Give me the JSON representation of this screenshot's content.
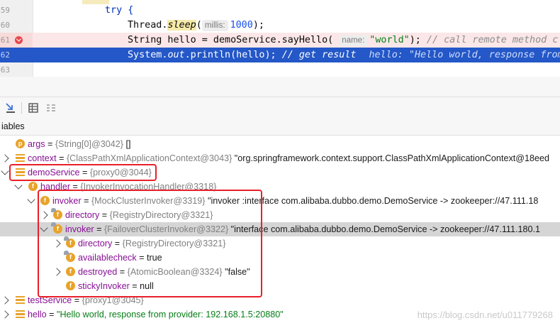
{
  "editor": {
    "lines": [
      {
        "num": "59",
        "text": "try {"
      },
      {
        "num": "60",
        "prefix": "Thread.",
        "method": "sleep",
        "hint": "millis:",
        "arg": "1000",
        "suffix": ");"
      },
      {
        "num": "61",
        "prefix": "String hello = demoService.sayHello(",
        "hint": "name:",
        "arg": "\"world\"",
        "suffix": ");",
        "comment": "// call remote method   c"
      },
      {
        "num": "62",
        "code": "System.",
        "field": "out",
        "rest": ".println(hello);",
        "comment": "// get result",
        "inline_value": "hello: \"Hello world, response from"
      },
      {
        "num": "63"
      }
    ]
  },
  "panel": {
    "title": "iables"
  },
  "tree": [
    {
      "name": "args",
      "type": "{String[0]@3042}",
      "value": "[]"
    },
    {
      "name": "context",
      "type": "{ClassPathXmlApplicationContext@3043}",
      "value": "\"org.springframework.context.support.ClassPathXmlApplicationContext@18eed"
    },
    {
      "name": "demoService",
      "type": "{proxy0@3044}",
      "value": ""
    },
    {
      "name": "handler",
      "type": "{InvokerInvocationHandler@3318}",
      "value": ""
    },
    {
      "name": "invoker",
      "type": "{MockClusterInvoker@3319}",
      "value": "\"invoker :interface com.alibaba.dubbo.demo.DemoService -> zookeeper://47.111.18"
    },
    {
      "name": "directory",
      "type": "{RegistryDirectory@3321}",
      "value": ""
    },
    {
      "name": "invoker",
      "type": "{FailoverClusterInvoker@3322}",
      "value": "\"interface com.alibaba.dubbo.demo.DemoService -> zookeeper://47.111.180.1"
    },
    {
      "name": "directory",
      "type": "{RegistryDirectory@3321}",
      "value": ""
    },
    {
      "name": "availablecheck",
      "type": "",
      "value": "= true"
    },
    {
      "name": "destroyed",
      "type": "{AtomicBoolean@3324}",
      "value": "\"false\""
    },
    {
      "name": "stickyInvoker",
      "type": "",
      "value": "= null"
    },
    {
      "name": "testService",
      "type": "{proxy1@3045}",
      "value": ""
    },
    {
      "name": "hello",
      "type": "",
      "value": "\"Hello world, response from provider: 192.168.1.5:20880\""
    }
  ],
  "watermark": "https://blog.csdn.net/u011779268",
  "colors": {
    "highlight": "#2457c7",
    "breakpoint": "#e5484d",
    "annotation": "#e8202a",
    "field_icon": "#e8a32a"
  }
}
